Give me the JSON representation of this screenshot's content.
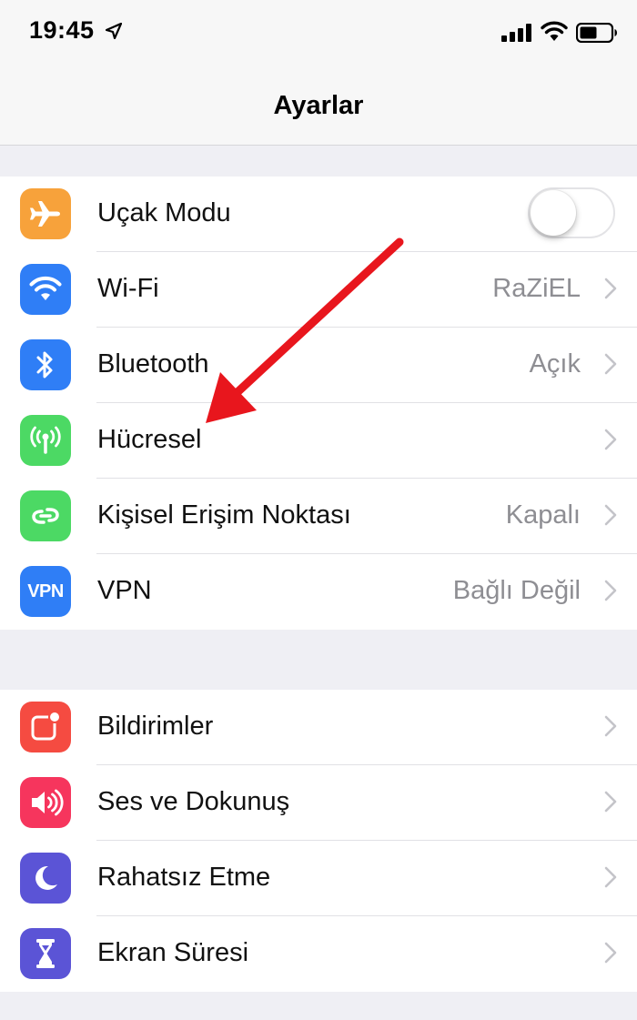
{
  "status_bar": {
    "time": "19:45"
  },
  "nav": {
    "title": "Ayarlar"
  },
  "group1": {
    "airplane": {
      "label": "Uçak Modu",
      "toggle_on": false
    },
    "wifi": {
      "label": "Wi-Fi",
      "value": "RaZiEL"
    },
    "bluetooth": {
      "label": "Bluetooth",
      "value": "Açık"
    },
    "cellular": {
      "label": "Hücresel",
      "value": ""
    },
    "hotspot": {
      "label": "Kişisel Erişim Noktası",
      "value": "Kapalı"
    },
    "vpn": {
      "label": "VPN",
      "value": "Bağlı Değil",
      "icon_text": "VPN"
    }
  },
  "group2": {
    "notifications": {
      "label": "Bildirimler"
    },
    "sounds": {
      "label": "Ses ve Dokunuş"
    },
    "dnd": {
      "label": "Rahatsız Etme"
    },
    "screen_time": {
      "label": "Ekran Süresi"
    }
  },
  "colors": {
    "orange": "#f7a23b",
    "blue": "#2f7ef6",
    "green": "#4cd964",
    "red": "#f54b41",
    "pink": "#f6355d",
    "purple": "#5b54d6",
    "annotation_arrow": "#e8161d"
  },
  "icons": [
    "location-arrow-icon",
    "cell-signal-icon",
    "wifi-icon",
    "battery-icon",
    "airplane-icon",
    "bluetooth-icon",
    "antenna-icon",
    "chain-link-icon",
    "bell-badge-icon",
    "speaker-icon",
    "moon-icon",
    "hourglass-icon",
    "chevron-right-icon"
  ]
}
